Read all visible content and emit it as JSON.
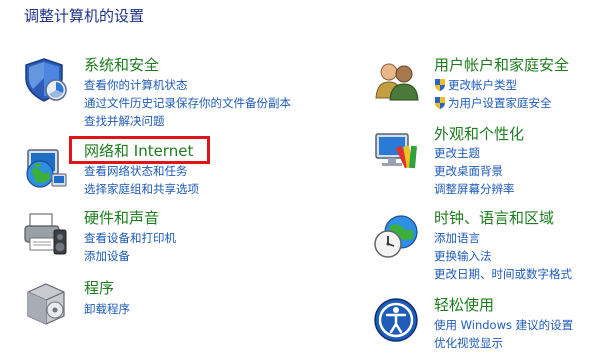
{
  "page": {
    "title": "调整计算机的设置"
  },
  "categories": {
    "system": {
      "title": "系统和安全",
      "links": [
        "查看你的计算机状态",
        "通过文件历史记录保存你的文件备份副本",
        "查找并解决问题"
      ]
    },
    "network": {
      "title": "网络和 Internet",
      "links": [
        "查看网络状态和任务",
        "选择家庭组和共享选项"
      ]
    },
    "hardware": {
      "title": "硬件和声音",
      "links": [
        "查看设备和打印机",
        "添加设备"
      ]
    },
    "programs": {
      "title": "程序",
      "links": [
        "卸载程序"
      ]
    },
    "users": {
      "title": "用户帐户和家庭安全",
      "links": [
        "更改帐户类型",
        "为用户设置家庭安全"
      ]
    },
    "appearance": {
      "title": "外观和个性化",
      "links": [
        "更改主题",
        "更改桌面背景",
        "调整屏幕分辨率"
      ]
    },
    "clock": {
      "title": "时钟、语言和区域",
      "links": [
        "添加语言",
        "更换输入法",
        "更改日期、时间或数字格式"
      ]
    },
    "ease": {
      "title": "轻松使用",
      "links": [
        "使用 Windows 建议的设置",
        "优化视觉显示"
      ]
    }
  },
  "colors": {
    "title": "#1e3287",
    "category": "#1e7c1e",
    "link": "#1e5bb8",
    "highlight": "#e0131b"
  },
  "icons": {
    "system": "security-shield-icon",
    "network": "network-globe-icon",
    "hardware": "printer-speaker-icon",
    "programs": "programs-box-icon",
    "users": "users-icon",
    "appearance": "monitor-palette-icon",
    "clock": "clock-globe-icon",
    "ease": "ease-of-access-icon",
    "uac": "uac-shield-icon"
  }
}
